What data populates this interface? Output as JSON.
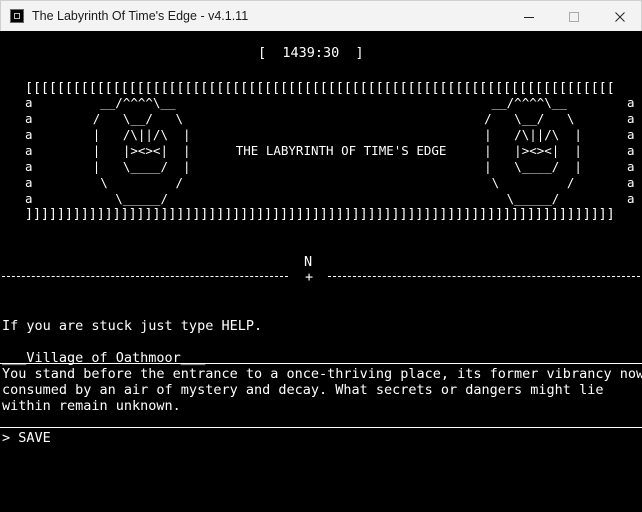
{
  "window": {
    "title": "The Labyrinth Of Time's Edge - v4.1.11",
    "controls": {
      "minimize": "minimize-icon",
      "maximize": "maximize-icon",
      "close": "close-icon"
    }
  },
  "terminal": {
    "clock_line": "[  1439:30  ]",
    "banner": {
      "top_border": "[[[[[[[[[[[[[[[[[[[[[[[[[[[[[[[[[[[[[[[[[[[[[[[[[[[[[[[[[[[[[[[[[[[[[[[[[[",
      "rows": [
        "a         __/^^^^\\__                                          __/^^^^\\__        a",
        "a        /   \\__/   \\                                        /   \\__/   \\       a",
        "a        |   /\\||/\\  |                                       |   /\\||/\\  |      a",
        "a        |   |><><|  |      THE LABYRINTH OF TIME'S EDGE     |   |><><|  |      a",
        "a        |   \\____/  |                                       |   \\____/  |      a",
        "a         \\         /                                         \\         /       a",
        "a           \\_____/                                             \\_____/         a"
      ],
      "bottom_border": "]]]]]]]]]]]]]]]]]]]]]]]]]]]]]]]]]]]]]]]]]]]]]]]]]]]]]]]]]]]]]]]]]]]]]]]]]]"
    },
    "compass": {
      "north": "N",
      "marker": "+"
    },
    "help_hint": "If you are stuck just type HELP.",
    "location_name": "___Village of Oathmoor___",
    "description": [
      "You stand before the entrance to a once-thriving place, its former vibrancy now",
      "consumed by an air of mystery and decay. What secrets or dangers might lie",
      "within remain unknown."
    ],
    "prompt": "> SAVE"
  }
}
